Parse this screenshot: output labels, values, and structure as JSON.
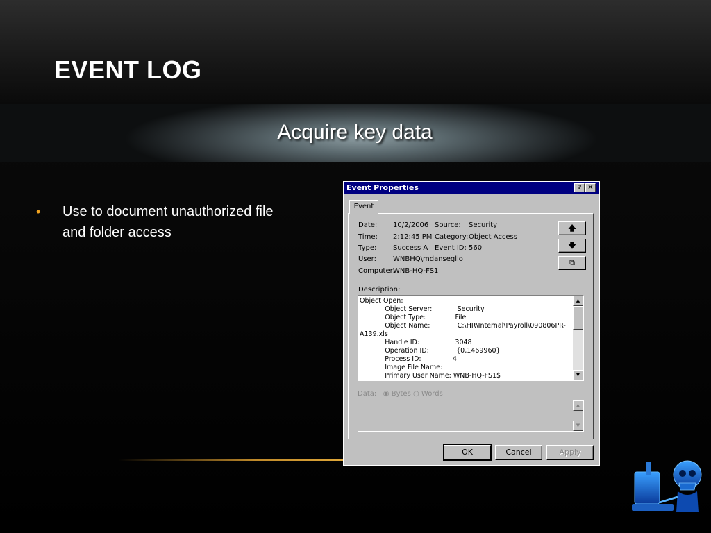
{
  "slide": {
    "title": "EVENT LOG",
    "subtitle": "Acquire key data",
    "bullets": [
      "Use to document unauthorized file and folder access"
    ]
  },
  "dialog": {
    "title": "Event Properties",
    "help_glyph": "?",
    "close_glyph": "✕",
    "tab_label": "Event",
    "fields": {
      "date_label": "Date:",
      "date_value": "10/2/2006",
      "source_label": "Source:",
      "source_value": "Security",
      "time_label": "Time:",
      "time_value": "2:12:45 PM",
      "category_label": "Category:",
      "category_value": "Object Access",
      "type_label": "Type:",
      "type_value": "Success A",
      "eventid_label": "Event ID:",
      "eventid_value": "560",
      "user_label": "User:",
      "user_value": "WNBHQ\\mdanseglio",
      "computer_label": "Computer:",
      "computer_value": "WNB-HQ-FS1"
    },
    "side_buttons": {
      "up": "🡅",
      "down": "🡇",
      "copy": "⧉"
    },
    "description_label": "Description:",
    "description_text": "Object Open:\n            Object Server:            Security\n            Object Type:              File\n            Object Name:             C:\\HR\\Internal\\Payroll\\090806PR-\nA139.xls\n            Handle ID:                 3048\n            Operation ID:             {0,1469960}\n            Process ID:               4\n            Image File Name:\n            Primary User Name: WNB-HQ-FS1$",
    "data_label": "Data:",
    "data_options": [
      "Bytes",
      "Words"
    ],
    "buttons": {
      "ok": "OK",
      "cancel": "Cancel",
      "apply": "Apply"
    }
  },
  "colors": {
    "accent_bullet": "#f0a21f",
    "titlebar": "#000080",
    "dialog_face": "#c0c0c0"
  },
  "icons": {
    "logo": "skull-hacker-at-computer-icon"
  }
}
